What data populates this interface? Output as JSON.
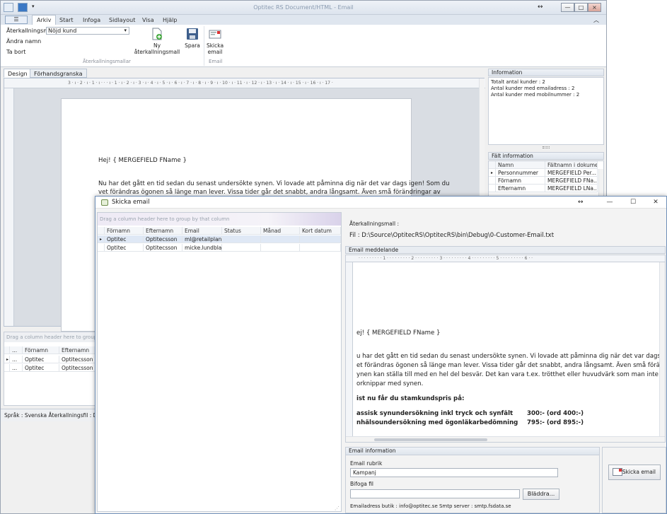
{
  "main_window": {
    "title": "Optitec RS Document/HTML - Email",
    "move_glyph": "↔",
    "controls": {
      "minimize": "—",
      "maximize": "□",
      "close": "×"
    },
    "ribbon_collapse_glyph": "︿"
  },
  "ribbon": {
    "file_tab": "☰",
    "tabs": [
      "Arkiv",
      "Start",
      "Infoga",
      "Sidlayout",
      "Visa",
      "Hjälp"
    ],
    "combo_label": "Återkallningsmall",
    "combo_value": "Nöjd kund",
    "rename": "Ändra namn",
    "delete": "Ta bort",
    "new_template": "Ny återkallningsmall",
    "save": "Spara",
    "send_email": "Skicka email",
    "group_templates": "Återkallningsmallar",
    "group_email": "Email"
  },
  "doc_tabs": [
    "Design",
    "Förhandsgranska"
  ],
  "ruler_text": "3 · ı · 2 · ı · 1 · ı · · · ı · 1 · ı · 2 · ı · 3 · ı · 4 · ı · 5 · ı · 6 · ı · 7 · ı · 8 · ı · 9 · ı · 10 · ı · 11 · ı · 12 · ı · 13 · ı · 14 · ı · 15 · ı · 16 · ı · 17 ·",
  "document": {
    "greeting": "Hej! { MERGEFIELD FName }",
    "line1": "Nu har det gått en tid sedan du senast undersökte synen. Vi lovade att påminna dig när det var dags igen! Som du",
    "line2": "vet förändras ögonen så länge man lever. Vissa tider går det snabbt, andra långsamt. Även små förändringar av"
  },
  "information": {
    "header": "Information",
    "lines": [
      "Totalt antal kunder : 2",
      "Antal kunder med emailadress : 2",
      "Antal kunder med mobilnummer : 2"
    ]
  },
  "field_info": {
    "header": "Fält information",
    "columns": [
      "Namn",
      "Fältnamn i dokument"
    ],
    "rows": [
      [
        "Personnummer",
        "MERGEFIELD Per..."
      ],
      [
        "Förnamn",
        "MERGEFIELD FNa..."
      ],
      [
        "Efternamn",
        "MERGEFIELD LNa..."
      ]
    ]
  },
  "left_grid": {
    "group_hint": "Drag a column header here to group by that column",
    "columns": [
      "...",
      "Förnamn",
      "Efternamn"
    ],
    "rows": [
      [
        "...",
        "Optitec",
        "Optitecsson"
      ],
      [
        "...",
        "Optitec",
        "Optitecsson"
      ]
    ]
  },
  "statusbar": "Språk : Svenska   Återkallningsfil : D:\\Source\\OptitecRS",
  "dialog": {
    "title": "Skicka email",
    "move_glyph": "↔",
    "controls": {
      "minimize": "—",
      "maximize": "☐",
      "close": "✕"
    },
    "group_hint": "Drag a column header here to group by that column",
    "columns": [
      "Förnamn",
      "Efternamn",
      "Email",
      "Status",
      "Månad",
      "Kort datum"
    ],
    "rows": [
      [
        "Optitec",
        "Optitecsson",
        "ml@retailplan...",
        "",
        "",
        ""
      ],
      [
        "Optitec",
        "Optitecsson",
        "micke.lundbla...",
        "",
        "",
        ""
      ]
    ],
    "template_label": "Återkallningsmall :",
    "file_label": "Fil :  D:\\Source\\OptitecRS\\OptitecRS\\bin\\Debug\\0-Customer-Email.txt",
    "email_message_header": "Email meddelande",
    "ruler_text": "· · · · · · · · · 1 · · · · · · · · · 2 · · · · · · · · · 3 · · · · · · · · · 4 · · · · · · · · · 5 · · · · · · · · · 6 · ·",
    "email_body": {
      "greeting": "ej! { MERGEFIELD FName }",
      "p1": "u har det gått en tid sedan du senast undersökte synen. Vi lovade att påminna dig när det var dags igen! Sc",
      "p2": "et förändras ögonen så länge man lever. Vissa tider går det snabbt, andra långsamt. Även små förändringar",
      "p3": "ynen kan ställa till med en hel del besvär. Det kan vara t.ex. trötthet eller huvudvärk som man inte direkt",
      "p4": "orknippar med synen.",
      "offer": "ist nu får du stamkundspris på:",
      "item1": "assisk synundersökning inkl tryck och synfält",
      "price1": "300:- (ord 400:-)",
      "item2": "nhälsoundersökning med ögonläkarbedömning",
      "price2": "795:- (ord 895:-)"
    },
    "email_info_header": "Email information",
    "subject_label": "Email rubrik",
    "subject_value": "Kampanj",
    "attach_label": "Bifoga fil",
    "attach_value": "",
    "browse_button": "Bläddra...",
    "footer": "Emailadress butik : info@optitec.se  Smtp server : smtp.fsdata.se",
    "send_button": "Skicka email"
  }
}
